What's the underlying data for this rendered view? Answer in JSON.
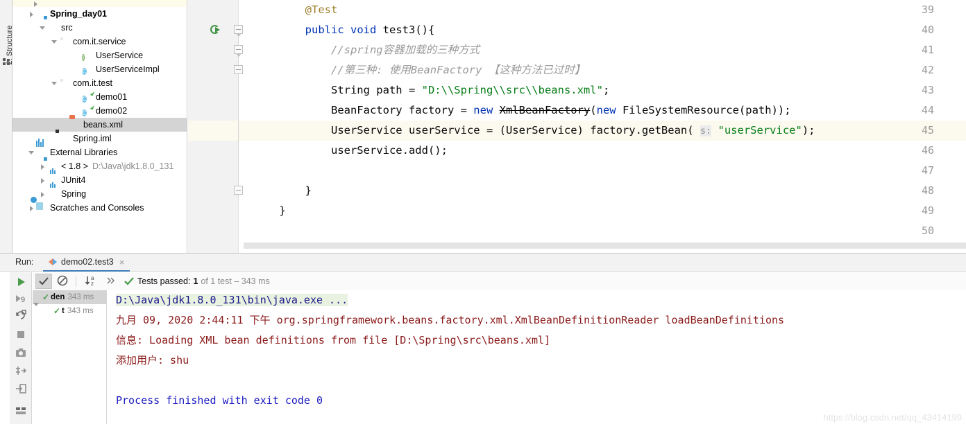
{
  "left_strip": {
    "structure_tab": "2: Structure",
    "structure_icon": "structure-icon"
  },
  "project_tree": {
    "rows": [
      {
        "label": "",
        "indent": 28,
        "icon": "folder-icon",
        "arrow": "right",
        "partial": true,
        "bold": false,
        "selected": false
      },
      {
        "label": "Spring_day01",
        "indent": 22,
        "icon": "module-folder-icon",
        "arrow": "right",
        "bold": true,
        "selected": false
      },
      {
        "label": "src",
        "indent": 38,
        "icon": "source-folder-icon",
        "arrow": "down",
        "bold": false,
        "selected": false
      },
      {
        "label": "com.it.service",
        "indent": 55,
        "icon": "package-icon",
        "arrow": "down",
        "bold": false,
        "selected": false
      },
      {
        "label": "UserService",
        "indent": 88,
        "icon": "interface-icon",
        "arrow": "none",
        "bold": false,
        "selected": false
      },
      {
        "label": "UserServiceImpl",
        "indent": 88,
        "icon": "class-icon",
        "arrow": "none",
        "bold": false,
        "selected": false
      },
      {
        "label": "com.it.test",
        "indent": 55,
        "icon": "package-icon",
        "arrow": "down",
        "bold": false,
        "selected": false
      },
      {
        "label": "demo01",
        "indent": 88,
        "icon": "test-class-icon",
        "arrow": "none",
        "bold": false,
        "selected": false
      },
      {
        "label": "demo02",
        "indent": 88,
        "icon": "test-class-icon",
        "arrow": "none",
        "bold": false,
        "selected": false
      },
      {
        "label": "beans.xml",
        "indent": 70,
        "icon": "xml-file-icon",
        "arrow": "none",
        "bold": false,
        "selected": true
      },
      {
        "label": "Spring.iml",
        "indent": 55,
        "icon": "iml-file-icon",
        "arrow": "none",
        "bold": false,
        "selected": false
      },
      {
        "label": "External Libraries",
        "indent": 22,
        "icon": "libraries-icon",
        "arrow": "down",
        "bold": false,
        "selected": false
      },
      {
        "label": "< 1.8 >",
        "indent": 38,
        "icon": "jdk-icon",
        "arrow": "right",
        "bold": false,
        "selected": false,
        "suffix": "D:\\Java\\jdk1.8.0_131"
      },
      {
        "label": "JUnit4",
        "indent": 38,
        "icon": "jar-icon",
        "arrow": "right",
        "bold": false,
        "selected": false
      },
      {
        "label": "Spring",
        "indent": 38,
        "icon": "jar-icon",
        "arrow": "right",
        "bold": false,
        "selected": false
      },
      {
        "label": "Scratches and Consoles",
        "indent": 22,
        "icon": "scratches-icon",
        "arrow": "right",
        "bold": false,
        "selected": false
      }
    ]
  },
  "editor": {
    "line_numbers": [
      "39",
      "40",
      "41",
      "42",
      "43",
      "44",
      "45",
      "46",
      "47",
      "48",
      "49",
      "50"
    ],
    "highlighted_line": "45",
    "run_gutter_line": "40",
    "lines": [
      {
        "num": "39",
        "segments": [
          {
            "t": "        ",
            "c": "k-txt"
          },
          {
            "t": "@Test",
            "c": "k-ann"
          }
        ]
      },
      {
        "num": "40",
        "segments": [
          {
            "t": "        ",
            "c": "k-txt"
          },
          {
            "t": "public",
            "c": "k-kw"
          },
          {
            "t": " ",
            "c": "k-txt"
          },
          {
            "t": "void",
            "c": "k-kw"
          },
          {
            "t": " test3(){",
            "c": "k-txt"
          }
        ]
      },
      {
        "num": "41",
        "segments": [
          {
            "t": "            //spring容器加载的三种方式",
            "c": "k-cmt"
          }
        ]
      },
      {
        "num": "42",
        "segments": [
          {
            "t": "            //第三种: 使用BeanFactory 【这种方法已过时】",
            "c": "k-cmt"
          }
        ]
      },
      {
        "num": "43",
        "segments": [
          {
            "t": "            String path = ",
            "c": "k-txt"
          },
          {
            "t": "\"D:\\\\Spring\\\\src\\\\beans.xml\"",
            "c": "k-str"
          },
          {
            "t": ";",
            "c": "k-txt"
          }
        ]
      },
      {
        "num": "44",
        "segments": [
          {
            "t": "            BeanFactory factory = ",
            "c": "k-txt"
          },
          {
            "t": "new",
            "c": "k-kw"
          },
          {
            "t": " ",
            "c": "k-txt"
          },
          {
            "t": "XmlBeanFactory",
            "c": "k-dep"
          },
          {
            "t": "(",
            "c": "k-txt"
          },
          {
            "t": "new",
            "c": "k-kw"
          },
          {
            "t": " FileSystemResource(path));",
            "c": "k-txt"
          }
        ]
      },
      {
        "num": "45",
        "segments": [
          {
            "t": "            UserService userService = (UserService) factory.getBean( ",
            "c": "k-txt"
          },
          {
            "t": "s:",
            "c": "k-hint"
          },
          {
            "t": " ",
            "c": "k-txt"
          },
          {
            "t": "\"userService\"",
            "c": "k-str"
          },
          {
            "t": ");",
            "c": "k-txt"
          }
        ]
      },
      {
        "num": "46",
        "segments": [
          {
            "t": "            userService.add();",
            "c": "k-txt"
          }
        ]
      },
      {
        "num": "47",
        "segments": [
          {
            "t": "",
            "c": "k-txt"
          }
        ]
      },
      {
        "num": "48",
        "segments": [
          {
            "t": "        }",
            "c": "k-txt"
          }
        ]
      },
      {
        "num": "49",
        "segments": [
          {
            "t": "    }",
            "c": "k-txt"
          }
        ]
      },
      {
        "num": "50",
        "segments": [
          {
            "t": "",
            "c": "k-txt"
          }
        ]
      }
    ]
  },
  "run_panel": {
    "label": "Run:",
    "tab_title": "demo02.test3",
    "tab_close": "×",
    "tab_icon": "run-test-icon",
    "side_buttons": [
      {
        "name": "rerun-icon"
      },
      {
        "name": "rerun-failed-icon"
      },
      {
        "name": "toggle-auto-test-icon"
      },
      {
        "name": "stop-icon"
      },
      {
        "name": "screenshot-icon"
      },
      {
        "name": "export-test-results-icon"
      },
      {
        "name": "import-test-results-icon"
      },
      {
        "name": "layout-icon"
      }
    ],
    "toolbar": {
      "show_passed_icon": "show-passed-checkmark-icon",
      "hide_ignored_icon": "hide-ignored-icon",
      "sort_icon": "sort-alphabetically-icon",
      "more_icon": "more-options-icon",
      "status_icon": "passed-checkmark-icon",
      "status_prefix": "Tests passed:",
      "status_count": "1",
      "status_suffix": "of 1 test – 343 ms"
    },
    "test_tree": [
      {
        "name": "den",
        "time": "343 ms",
        "selected": true,
        "expanded": true,
        "indent": 0
      },
      {
        "name": "t",
        "time": "343 ms",
        "selected": false,
        "expanded": false,
        "indent": 16
      }
    ],
    "console": [
      {
        "text": "D:\\Java\\jdk1.8.0_131\\bin\\java.exe ...",
        "style": "c-cmd"
      },
      {
        "text": "九月 09, 2020 2:44:11 下午 org.springframework.beans.factory.xml.XmlBeanDefinitionReader loadBeanDefinitions",
        "style": "c-log"
      },
      {
        "text": "信息: Loading XML bean definitions from file [D:\\Spring\\src\\beans.xml]",
        "style": "c-log"
      },
      {
        "text": "添加用户: shu",
        "style": "c-log"
      },
      {
        "text": "",
        "style": "c-log"
      },
      {
        "text": "Process finished with exit code 0",
        "style": "c-blue"
      }
    ]
  },
  "watermark": "https://blog.csdn.net/qq_43414199"
}
